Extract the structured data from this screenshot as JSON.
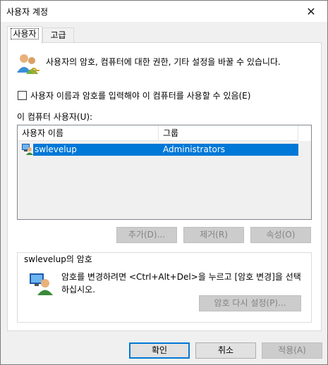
{
  "window": {
    "title": "사용자 계정",
    "close_glyph": "✕"
  },
  "tabs": [
    {
      "label": "사용자",
      "active": true
    },
    {
      "label": "고급",
      "active": false
    }
  ],
  "intro": {
    "icon": "users-icon",
    "text": "사용자의 암호, 컴퓨터에 대한 권한, 기타 설정을 바꿀 수 있습니다."
  },
  "require_login": {
    "label": "사용자 이름과 암호를 입력해야 이 컴퓨터를 사용할 수 있음(E)",
    "checked": false
  },
  "users_section": {
    "label": "이 컴퓨터 사용자(U):",
    "columns": [
      "사용자 이름",
      "그룹"
    ],
    "rows": [
      {
        "name": "swlevelup",
        "group": "Administrators",
        "selected": true,
        "icon": "user-icon"
      }
    ]
  },
  "user_buttons": {
    "add": "추가(D)...",
    "remove": "제거(R)",
    "properties": "속성(O)"
  },
  "password_group": {
    "title": "swlevelup의 암호",
    "text": "암호를 변경하려면 <Ctrl+Alt+Del>을 누르고 [암호 변경]을 선택하십시오.",
    "reset_button": "암호 다시 설정(P)...",
    "icon": "user-key-icon"
  },
  "dialog_buttons": {
    "ok": "확인",
    "cancel": "취소",
    "apply": "적용(A)"
  },
  "colors": {
    "selection": "#0078d7",
    "window_bg": "#f0f0f0",
    "panel_bg": "#ffffff"
  }
}
